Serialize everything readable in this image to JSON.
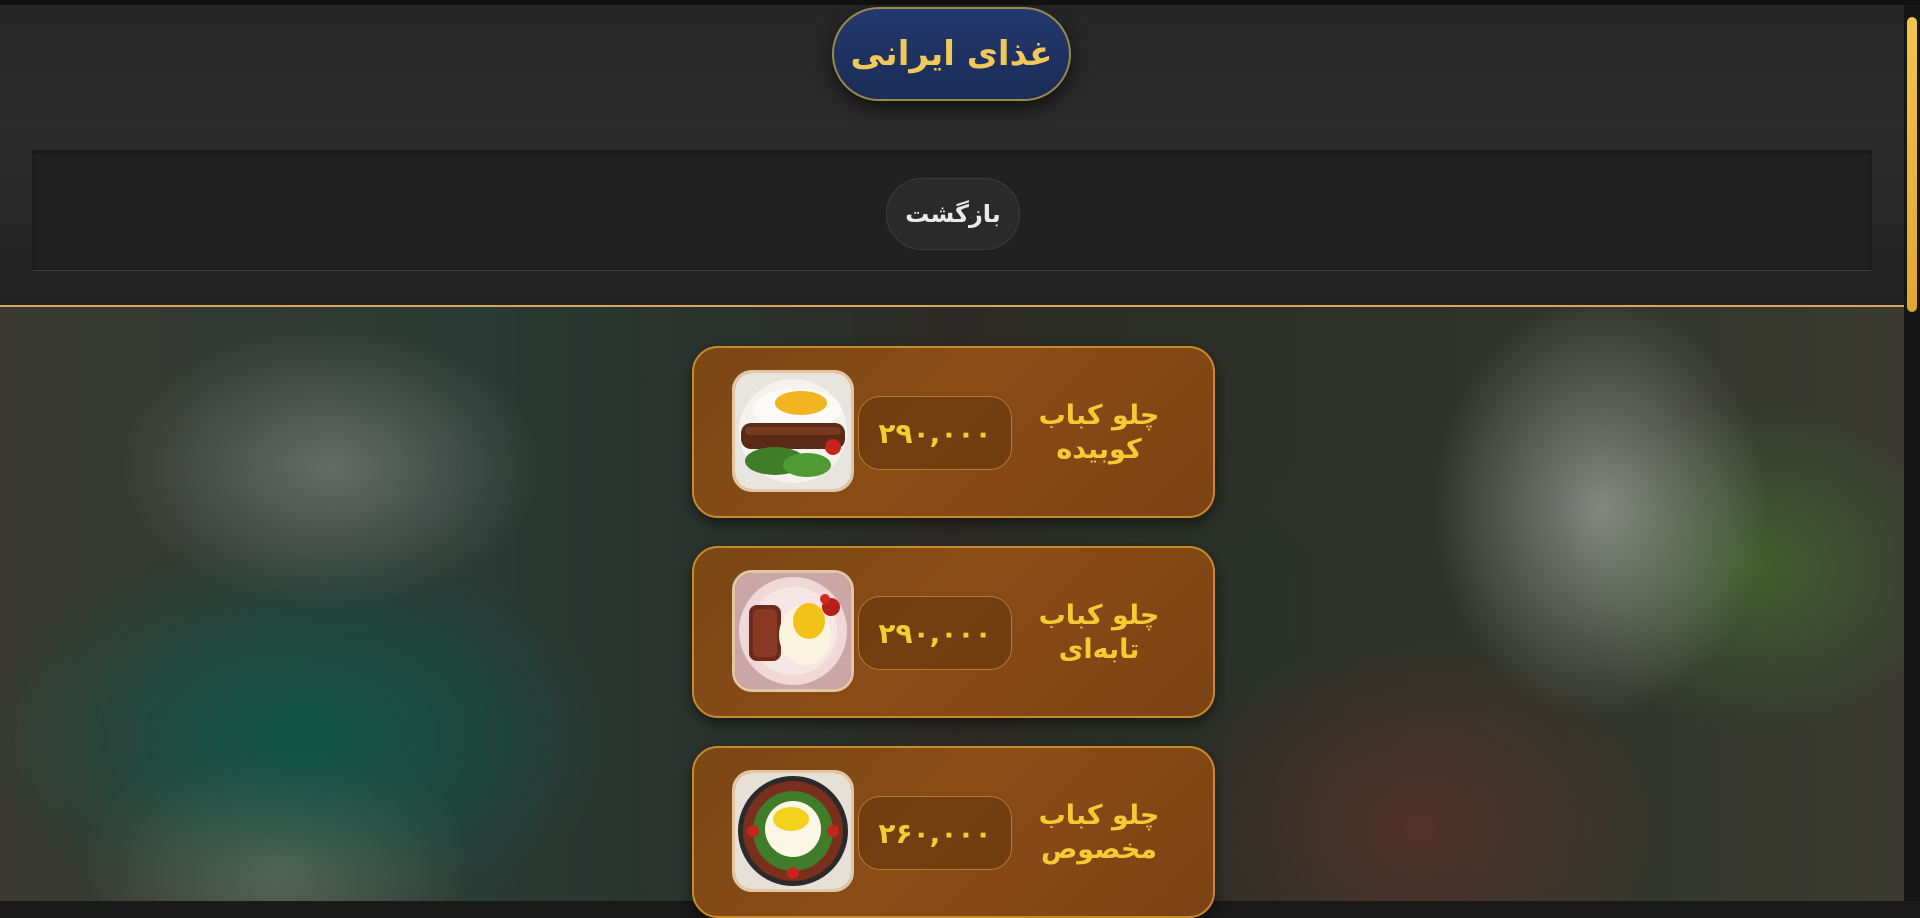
{
  "header": {
    "title": "غذای ایرانی",
    "back_label": "بازگشت"
  },
  "colors": {
    "accent": "#f4cc34",
    "title_pill": "#1f3263",
    "card": "#844915",
    "divider": "#d9a55a"
  },
  "menu_items": [
    {
      "name_line1": "چلو کباب",
      "name_line2": "کوبیده",
      "price": "۲۹۰,۰۰۰",
      "photo_icon": "kebab-koobideh-photo"
    },
    {
      "name_line1": "چلو کباب",
      "name_line2": "تابه‌ای",
      "price": "۲۹۰,۰۰۰",
      "photo_icon": "kebab-tabei-photo"
    },
    {
      "name_line1": "چلو کباب",
      "name_line2": "مخصوص",
      "price": "۲۶۰,۰۰۰",
      "photo_icon": "kebab-makhsoos-photo"
    }
  ]
}
